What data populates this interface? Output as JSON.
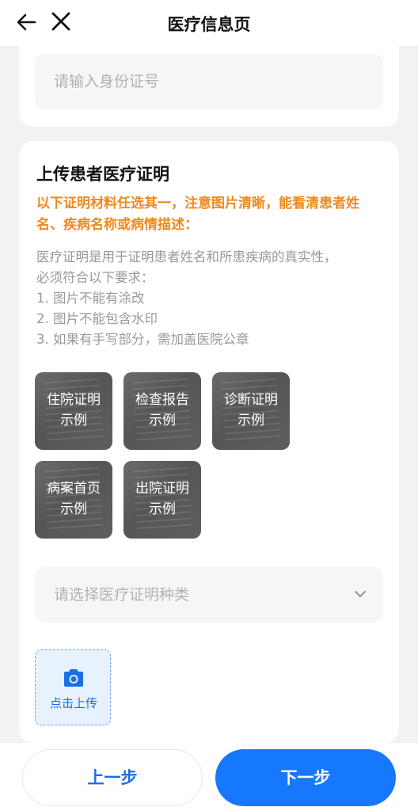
{
  "header": {
    "title": "医疗信息页",
    "back_icon": "arrow-left-icon",
    "close_icon": "close-icon"
  },
  "id_card": {
    "placeholder": "请输入身份证号"
  },
  "upload_section": {
    "title": "上传患者医疗证明",
    "warning": "以下证明材料任选其一，注意图片清晰，能看清患者姓名、疾病名称或病情描述：",
    "description_lines": [
      "医疗证明是用于证明患者姓名和所患疾病的真实性，",
      "必须符合以下要求：",
      "1. 图片不能有涂改",
      "2. 图片不能包含水印",
      "3. 如果有手写部分，需加盖医院公章"
    ],
    "examples": [
      {
        "line1": "住院证明",
        "line2": "示例"
      },
      {
        "line1": "检查报告",
        "line2": "示例"
      },
      {
        "line1": "诊断证明",
        "line2": "示例"
      },
      {
        "line1": "病案首页",
        "line2": "示例"
      },
      {
        "line1": "出院证明",
        "line2": "示例"
      }
    ],
    "type_select_placeholder": "请选择医疗证明种类",
    "upload_label": "点击上传",
    "upload_icon": "camera-icon"
  },
  "footer": {
    "prev_label": "上一步",
    "next_label": "下一步"
  },
  "colors": {
    "primary": "#1677ff",
    "warning": "#f08a1c",
    "upload_bg": "#e8f1fe"
  }
}
